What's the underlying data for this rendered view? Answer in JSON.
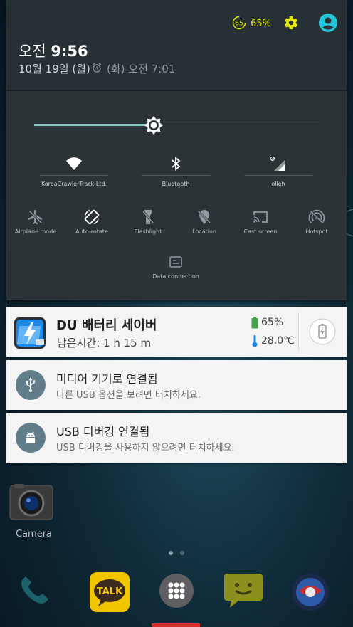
{
  "status": {
    "battery_ring_value": "65",
    "battery_percent": "65%",
    "colors": {
      "battery": "#e6e600",
      "gear": "#e6e600",
      "user": "#26c6da"
    }
  },
  "header": {
    "ampm": "오전",
    "time": "9:56",
    "date": "10월 19일 (월)",
    "alarm": "(화) 오전 7:01"
  },
  "brightness": {
    "level_fraction": 0.42
  },
  "tiles_main": [
    {
      "label": "KoreaCrawlerTrack Ltd.",
      "icon": "wifi-icon"
    },
    {
      "label": "Bluetooth",
      "icon": "bluetooth-icon"
    },
    {
      "label": "olleh",
      "icon": "signal-icon"
    }
  ],
  "tiles_row": [
    {
      "label": "Airplane mode",
      "icon": "airplane-icon"
    },
    {
      "label": "Auto-rotate",
      "icon": "auto-rotate-icon"
    },
    {
      "label": "Flashlight",
      "icon": "flashlight-icon"
    },
    {
      "label": "Location",
      "icon": "location-icon"
    },
    {
      "label": "Cast screen",
      "icon": "cast-icon"
    },
    {
      "label": "Hotspot",
      "icon": "hotspot-icon"
    }
  ],
  "tile_data": {
    "label": "Data connection",
    "icon": "data-connection-icon"
  },
  "notifications": {
    "du": {
      "title": "DU 배터리 세이버",
      "remaining": "남은시간: 1 h 15 m",
      "battery": "65%",
      "temperature": "28.0℃"
    },
    "usb": {
      "title": "미디어 기기로 연결됨",
      "subtitle": "다른 USB 옵션을 보려면 터치하세요."
    },
    "debug": {
      "title": "USB 디버깅 연결됨",
      "subtitle": "USB 디버깅을 사용하지 않으려면 터치하세요."
    }
  },
  "home": {
    "camera_label": "Camera",
    "kakao_label": "TALK"
  }
}
